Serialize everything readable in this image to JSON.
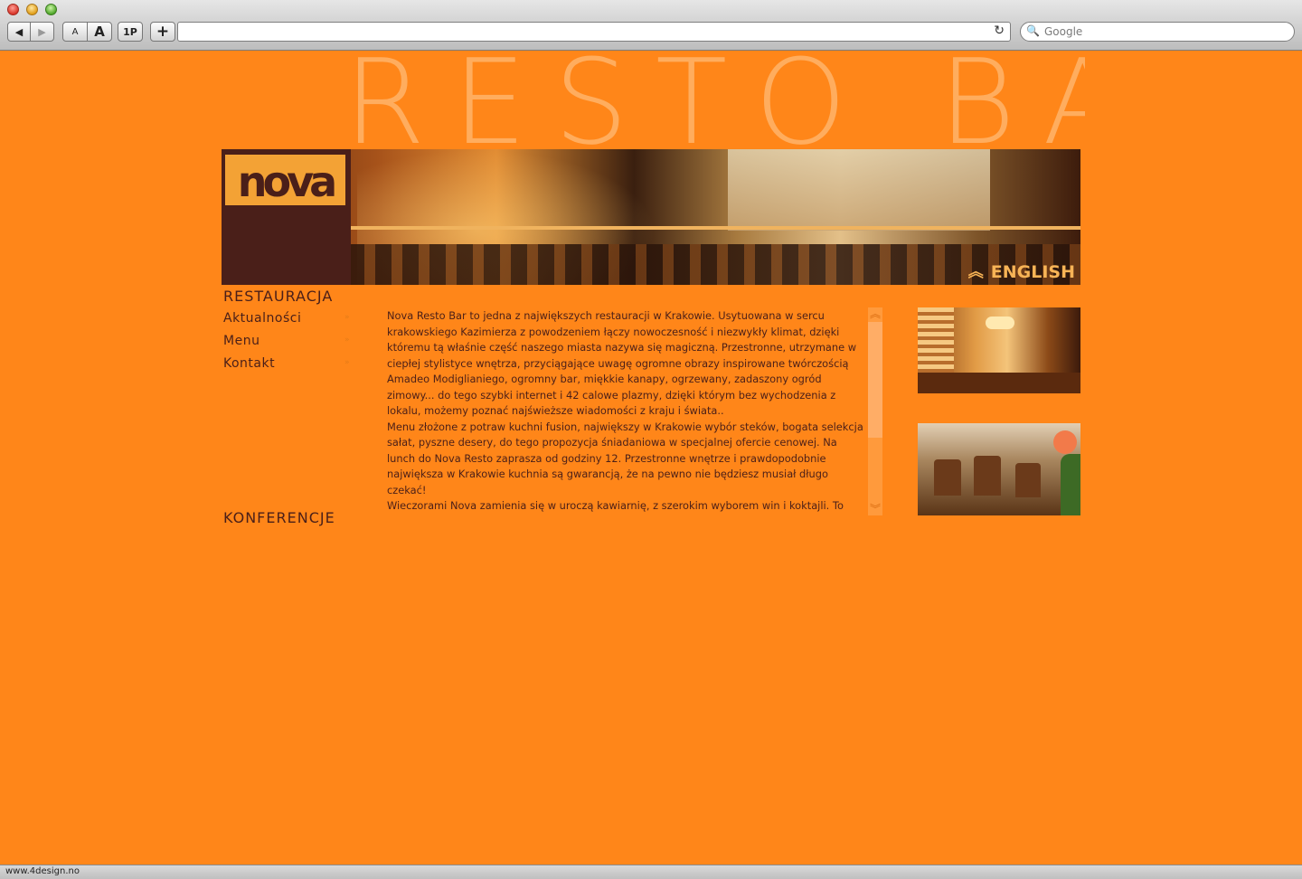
{
  "browser": {
    "address": "",
    "search_placeholder": "Google",
    "status_text": "www.4design.no",
    "buttons": {
      "back": "◀",
      "forward": "▶",
      "font_small": "A",
      "font_large": "A",
      "one_p": "1P",
      "add": "+",
      "reload": "↻",
      "search_icon": "🔍"
    }
  },
  "page": {
    "hero": "RESTO BAR",
    "logo": "nova",
    "language_link": "ENGLISH",
    "language_icon": "︽",
    "nav": {
      "section1": "RESTAURACJA",
      "items": [
        "Aktualności",
        "Menu",
        "Kontakt"
      ],
      "item_mark": "»",
      "section2": "KONFERENCJE"
    },
    "content": {
      "paragraphs": [
        "Nova Resto Bar to jedna z największych restauracji w Krakowie. Usytuowana w sercu krakowskiego Kazimierza z powodzeniem łączy nowoczesność i niezwykły klimat, dzięki któremu tą właśnie część naszego miasta nazywa się magiczną. Przestronne, utrzymane w ciepłej stylistyce wnętrza, przyciągające uwagę ogromne obrazy inspirowane twórczością Amadeo Modiglianiego, ogromny bar, miękkie kanapy, ogrzewany, zadaszony ogród zimowy... do tego szybki internet i 42 calowe plazmy, dzięki którym bez wychodzenia z lokalu, możemy poznać najświeższe wiadomości z kraju i świata..",
        "Menu złożone z potraw kuchni fusion, największy w Krakowie wybór steków, bogata selekcja sałat, pyszne desery, do tego propozycja śniadaniowa w specjalnej ofercie cenowej. Na lunch do Nova Resto zaprasza od godziny 12. Przestronne wnętrze i prawdopodobnie największa w Krakowie kuchnia są gwarancją, że na pewno nie będziesz musiał długo czekać!",
        "Wieczorami Nova zamienia się w uroczą kawiarnię, z szerokim wyborem win i koktajli. To idealne miejsce na długie spotkania z przyjaciółmi i kameralne imprezy... Takie, na które zaprosić można"
      ],
      "scroll_up": "︽",
      "scroll_down": "︾"
    },
    "colors": {
      "background": "#ff8619",
      "text": "#4a1f19",
      "hero_text": "#ffad5e",
      "accent": "#f8b456"
    }
  }
}
